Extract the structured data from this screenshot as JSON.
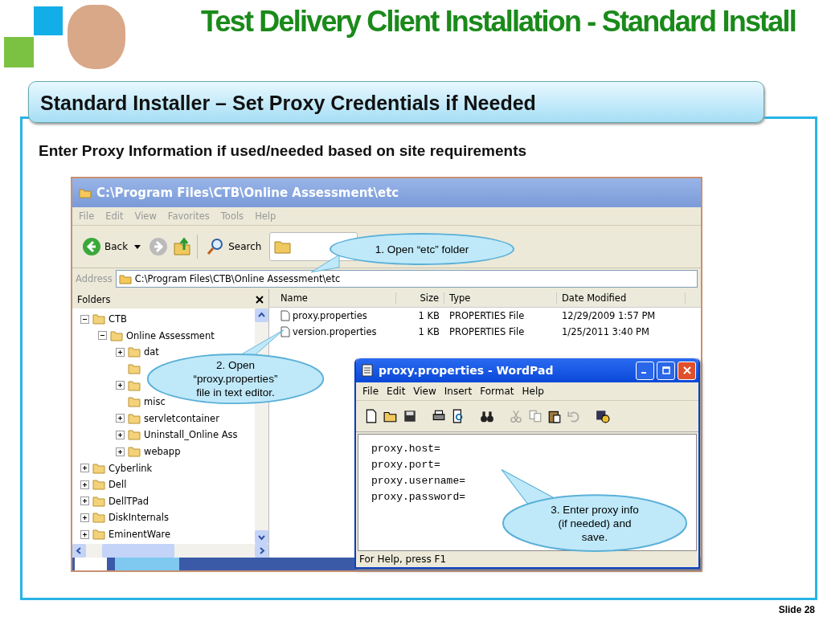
{
  "slide": {
    "title": "Test Delivery Client Installation - Standard Install",
    "heading": "Standard Installer – Set Proxy Credentials if Needed",
    "intro": "Enter Proxy Information if used/needed based on site requirements",
    "number": "Slide 28"
  },
  "explorer": {
    "title": "C:\\Program Files\\CTB\\Online Assessment\\etc",
    "menu": [
      "File",
      "Edit",
      "View",
      "Favorites",
      "Tools",
      "Help"
    ],
    "back_label": "Back",
    "search_label": "Search",
    "address_label": "Address",
    "address": "C:\\Program Files\\CTB\\Online Assessment\\etc",
    "folders_title": "Folders",
    "tree": [
      {
        "label": "CTB",
        "has_children": true,
        "expanded": true,
        "children": [
          {
            "label": "Online Assessment",
            "has_children": true,
            "expanded": true,
            "children": [
              {
                "label": "dat",
                "has_children": true,
                "expanded": false
              },
              {
                "has_children": false
              },
              {
                "has_children": true,
                "expanded": false
              },
              {
                "label": "misc",
                "has_children": false
              },
              {
                "label": "servletcontainer",
                "has_children": true,
                "expanded": false
              },
              {
                "label": "Uninstall_Online Ass",
                "has_children": true,
                "expanded": false
              },
              {
                "label": "webapp",
                "has_children": true,
                "expanded": false
              }
            ]
          }
        ]
      },
      {
        "label": "Cyberlink",
        "has_children": true,
        "expanded": false
      },
      {
        "label": "Dell",
        "has_children": true,
        "expanded": false
      },
      {
        "label": "DellTPad",
        "has_children": true,
        "expanded": false
      },
      {
        "label": "DiskInternals",
        "has_children": true,
        "expanded": false
      },
      {
        "label": "EminentWare",
        "has_children": true,
        "expanded": false
      }
    ],
    "columns": [
      "Name",
      "Size",
      "Type",
      "Date Modified"
    ],
    "files": [
      {
        "name": "proxy.properties",
        "size": "1 KB",
        "type": "PROPERTIES File",
        "modified": "12/29/2009 1:57 PM"
      },
      {
        "name": "version.properties",
        "size": "1 KB",
        "type": "PROPERTIES File",
        "modified": "1/25/2011 3:40 PM"
      }
    ]
  },
  "wordpad": {
    "title": "proxy.properties - WordPad",
    "menu": [
      "File",
      "Edit",
      "View",
      "Insert",
      "Format",
      "Help"
    ],
    "lines": [
      "proxy.host=",
      "proxy.port=",
      "proxy.username=",
      "proxy.password="
    ],
    "status": "For Help, press F1"
  },
  "callouts": [
    "1. Open “etc” folder",
    "2. Open\n“proxy.properties”\nfile in text editor.",
    "3. Enter proxy info\n(if needed) and\nsave."
  ]
}
